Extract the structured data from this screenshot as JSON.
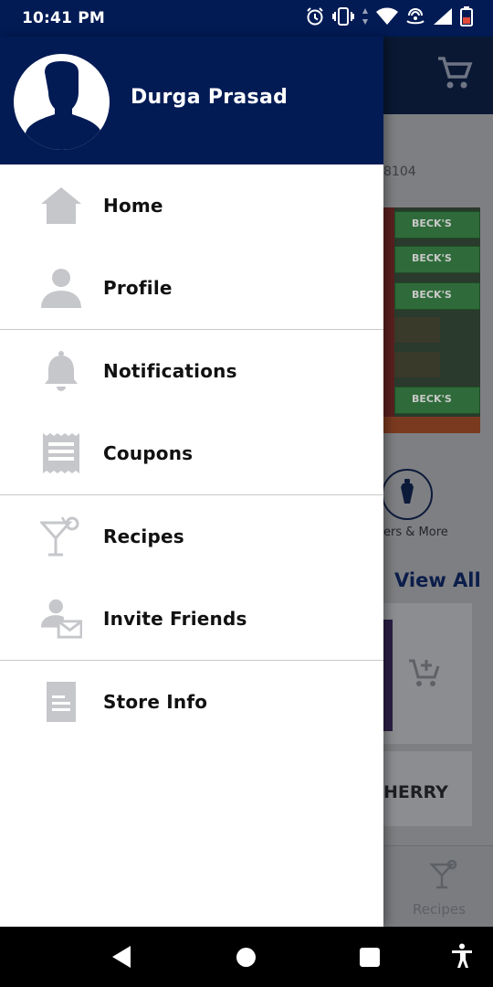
{
  "status_bar": {
    "time": "10:41 PM",
    "icons": [
      "alarm-icon",
      "vibrate-icon",
      "data-arrows-icon",
      "wifi-icon",
      "hotspot-icon",
      "signal-icon",
      "battery-low-icon"
    ]
  },
  "background": {
    "store_id_fragment": "8104",
    "banner_crate_text": "BECK'S",
    "category_label": "ers & More",
    "view_all": "View All",
    "product_name_fragment": "HERRY",
    "bottom_tab_label": "Recipes"
  },
  "drawer": {
    "user_name": "Durga Prasad",
    "menu_groups": [
      [
        {
          "label": "Home",
          "icon": "home-icon"
        },
        {
          "label": "Profile",
          "icon": "person-icon"
        }
      ],
      [
        {
          "label": "Notifications",
          "icon": "bell-icon"
        },
        {
          "label": "Coupons",
          "icon": "receipt-icon"
        }
      ],
      [
        {
          "label": "Recipes",
          "icon": "cocktail-icon"
        },
        {
          "label": "Invite Friends",
          "icon": "invite-friends-icon"
        }
      ],
      [
        {
          "label": "Store Info",
          "icon": "document-icon"
        }
      ]
    ]
  },
  "colors": {
    "header_navy": "#021b55",
    "icon_gray": "#c6c7cb",
    "scrim": "#7d7f82"
  },
  "nav_bar": {
    "buttons": [
      "back-icon",
      "home-circle-icon",
      "recents-icon",
      "accessibility-icon"
    ]
  }
}
